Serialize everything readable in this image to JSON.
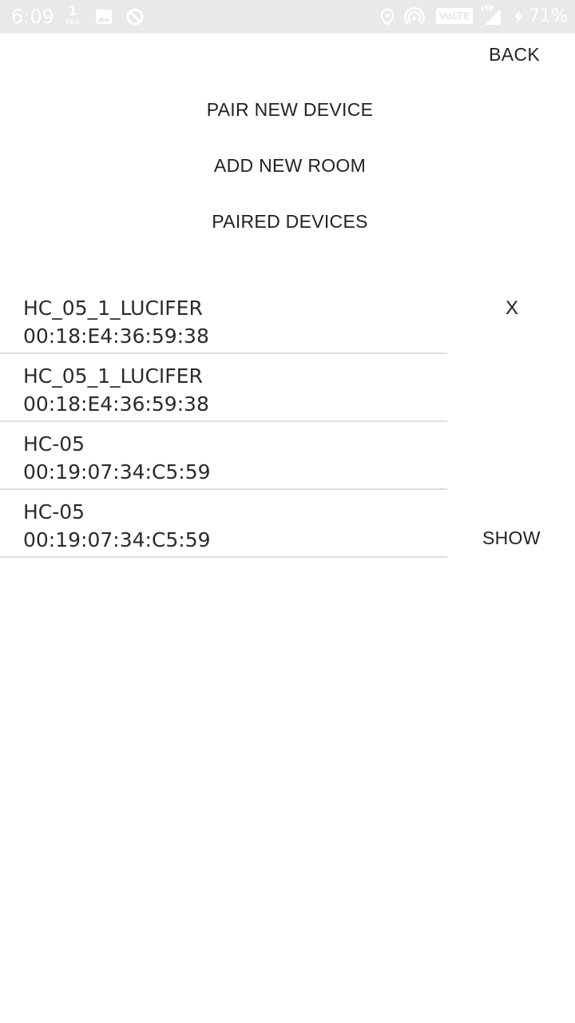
{
  "status_bar": {
    "time": "6:09",
    "net_speed_value": "1",
    "net_speed_unit": "KB/s",
    "volte": "VoLTE",
    "lte": "LTE",
    "battery": "71%",
    "icons": [
      "image-icon",
      "blocked-icon",
      "location-icon",
      "hotspot-icon",
      "signal-icon",
      "charging-icon"
    ]
  },
  "header": {
    "back_label": "BACK"
  },
  "menu": {
    "pair_new_device": "PAIR NEW DEVICE",
    "add_new_room": "ADD NEW ROOM",
    "paired_devices": "PAIRED DEVICES"
  },
  "devices": [
    {
      "name": "HC_05_1_LUCIFER",
      "address": "00:18:E4:36:59:38"
    },
    {
      "name": "HC_05_1_LUCIFER",
      "address": "00:18:E4:36:59:38"
    },
    {
      "name": "HC-05",
      "address": "00:19:07:34:C5:59"
    },
    {
      "name": "HC-05",
      "address": "00:19:07:34:C5:59"
    }
  ],
  "actions": {
    "close_label": "X",
    "show_label": "SHOW"
  },
  "colors": {
    "status_bar_bg": "#e9e9e9",
    "divider": "#dddddd",
    "text": "#222222"
  }
}
